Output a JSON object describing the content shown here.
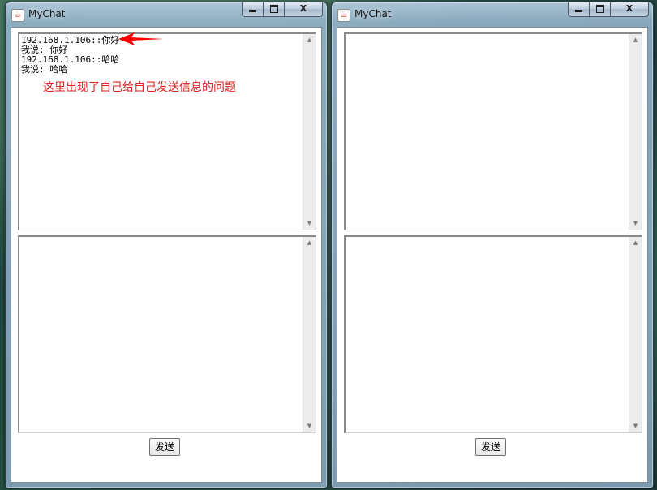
{
  "windows": [
    {
      "title": "MyChat",
      "chat_log": [
        "192.168.1.106::你好",
        "我说: 你好",
        "192.168.1.106::哈哈",
        "我说: 哈哈"
      ],
      "input_text": "",
      "send_label": "发送",
      "controls": {
        "minimize": "minimize",
        "maximize": "maximize",
        "close": "X"
      }
    },
    {
      "title": "MyChat",
      "chat_log": [],
      "input_text": "",
      "send_label": "发送",
      "controls": {
        "minimize": "minimize",
        "maximize": "maximize",
        "close": "X"
      }
    }
  ],
  "annotation": {
    "text": "这里出现了自己给自己发送信息的问题",
    "color": "#e02020",
    "arrow_color": "#ff0000"
  },
  "icons": {
    "app": "java-cup-icon",
    "scroll_up": "▲",
    "scroll_down": "▼"
  }
}
